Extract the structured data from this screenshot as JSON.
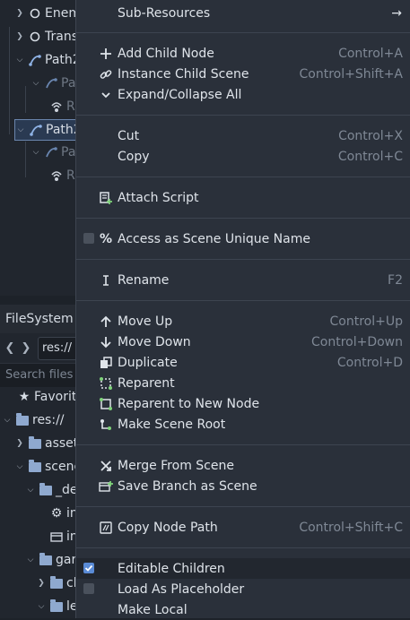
{
  "scene_tree": {
    "rows": [
      {
        "label": "Enem",
        "dim": false
      },
      {
        "label": "Trans",
        "dim": false
      },
      {
        "label": "Path2",
        "dim": false
      },
      {
        "label": "Pat",
        "dim": true
      },
      {
        "label": "R",
        "dim": true
      },
      {
        "label": "Path2",
        "dim": false
      },
      {
        "label": "Pat",
        "dim": true
      },
      {
        "label": "R",
        "dim": true
      }
    ]
  },
  "filesystem": {
    "title": "FileSystem",
    "path": "res://",
    "search_placeholder": "Search files",
    "rows": [
      {
        "label": "Favorit"
      },
      {
        "label": "res://"
      },
      {
        "label": "asset"
      },
      {
        "label": "scene"
      },
      {
        "label": "_de"
      },
      {
        "label": "in"
      },
      {
        "label": "in"
      },
      {
        "label": "gar"
      },
      {
        "label": "cl"
      },
      {
        "label": "le"
      }
    ]
  },
  "menu": {
    "sub_resources": "Sub-Resources",
    "items": {
      "add_child": {
        "label": "Add Child Node",
        "shortcut": "Control+A"
      },
      "instance_child": {
        "label": "Instance Child Scene",
        "shortcut": "Control+Shift+A"
      },
      "expand_collapse": {
        "label": "Expand/Collapse All"
      },
      "cut": {
        "label": "Cut",
        "shortcut": "Control+X"
      },
      "copy": {
        "label": "Copy",
        "shortcut": "Control+C"
      },
      "attach_script": {
        "label": "Attach Script"
      },
      "unique_name": {
        "label": "Access as Scene Unique Name"
      },
      "rename": {
        "label": "Rename",
        "shortcut": "F2"
      },
      "move_up": {
        "label": "Move Up",
        "shortcut": "Control+Up"
      },
      "move_down": {
        "label": "Move Down",
        "shortcut": "Control+Down"
      },
      "duplicate": {
        "label": "Duplicate",
        "shortcut": "Control+D"
      },
      "reparent": {
        "label": "Reparent"
      },
      "reparent_new": {
        "label": "Reparent to New Node"
      },
      "make_root": {
        "label": "Make Scene Root"
      },
      "merge": {
        "label": "Merge From Scene"
      },
      "save_branch": {
        "label": "Save Branch as Scene"
      },
      "copy_path": {
        "label": "Copy Node Path",
        "shortcut": "Control+Shift+C"
      },
      "editable_children": {
        "label": "Editable Children",
        "checked": true
      },
      "load_placeholder": {
        "label": "Load As Placeholder",
        "checked": false
      },
      "make_local": {
        "label": "Make Local"
      }
    }
  }
}
